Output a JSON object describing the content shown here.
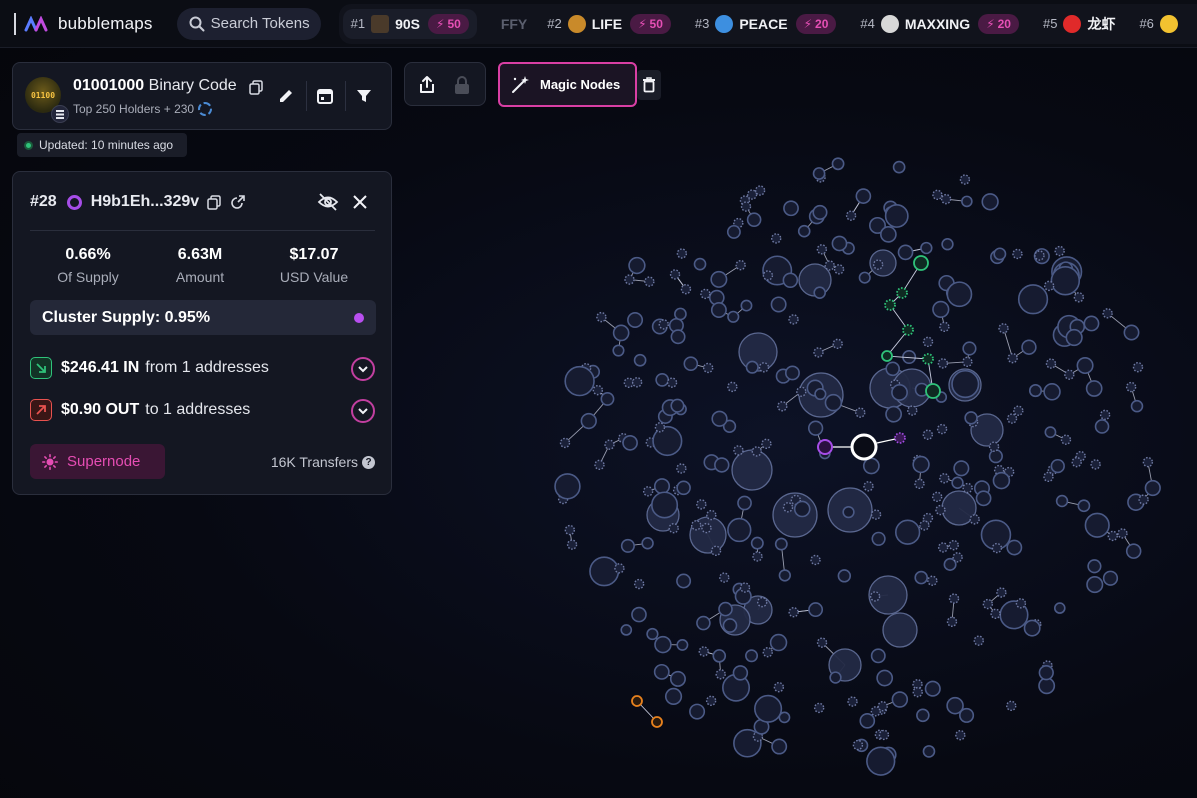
{
  "app": {
    "name": "bubblemaps"
  },
  "search": {
    "placeholder": "Search Tokens"
  },
  "ticker": [
    {
      "rank": "#1",
      "name": "90S",
      "boost": "50",
      "logo_color": "#4a3a2a"
    },
    {
      "rank": "#2",
      "name": "LIFE",
      "boost": "50",
      "logo_color": "#c98a2a"
    },
    {
      "rank": "#3",
      "name": "PEACE",
      "boost": "20",
      "logo_color": "#3d8fe0"
    },
    {
      "rank": "#4",
      "name": "MAXXING",
      "boost": "20",
      "logo_color": "#d8d8d8"
    },
    {
      "rank": "#5",
      "name": "龙虾",
      "boost": "",
      "logo_color": "#e02a2a"
    },
    {
      "rank": "#6",
      "name": "",
      "boost": "",
      "logo_color": "#f2c230"
    }
  ],
  "ticker_faded": "FFY",
  "token": {
    "symbol": "01001000",
    "name": "Binary Code",
    "subtitle": "Top 250 Holders + 230",
    "avatar_text": "01100",
    "updated": "Updated: 10 minutes ago"
  },
  "toolbar": {
    "magic_nodes_label": "Magic Nodes"
  },
  "wallet": {
    "rank": "#28",
    "address": "H9b1Eh...329v",
    "stats": [
      {
        "value": "0.66%",
        "label": "Of Supply"
      },
      {
        "value": "6.63M",
        "label": "Amount"
      },
      {
        "value": "$17.07",
        "label": "USD Value"
      }
    ],
    "cluster_supply": "Cluster Supply: 0.95%",
    "inflow": {
      "amount": "$246.41 IN",
      "text": "from 1 addresses"
    },
    "outflow": {
      "amount": "$0.90 OUT",
      "text": "to 1 addresses"
    },
    "supernode_label": "Supernode",
    "transfers": "16K Transfers"
  },
  "colors": {
    "accent_pink": "#d93fa4",
    "selected_purple": "#a64de8",
    "green_node": "#2fc37a",
    "orange_node": "#e8821e",
    "node_blue": "#4b5a86"
  }
}
